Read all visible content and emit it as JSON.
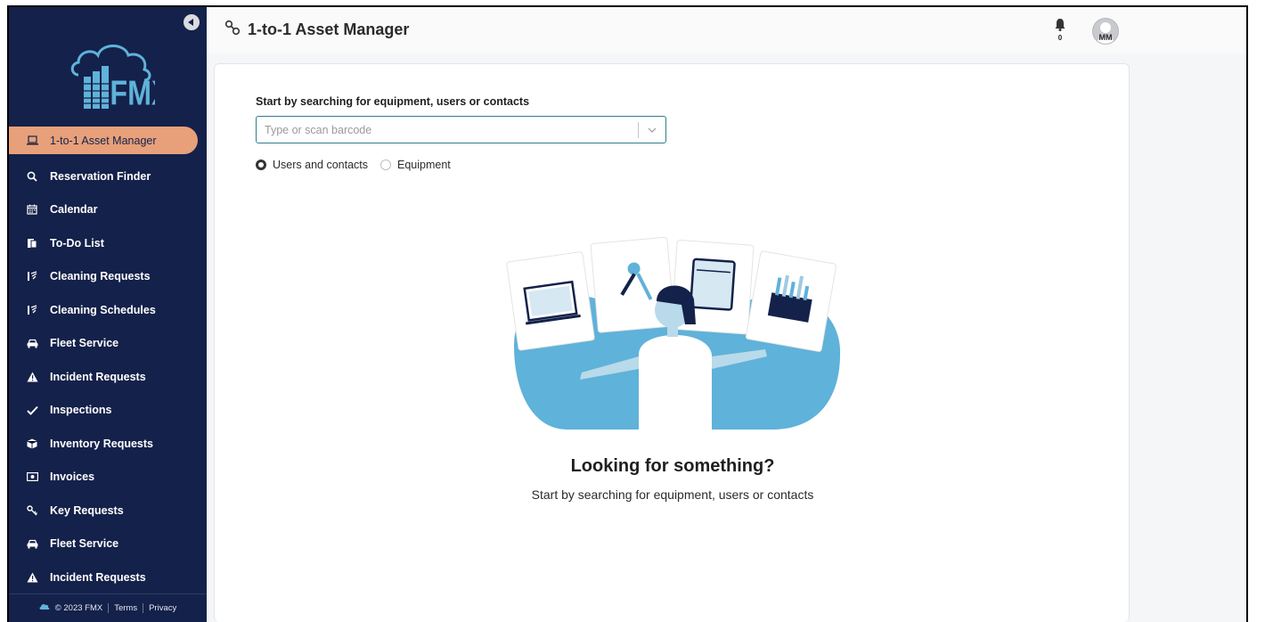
{
  "app": {
    "title": "1-to-1 Asset Manager"
  },
  "sidebar": {
    "logo_text": "FMX",
    "items": [
      {
        "label": "1-to-1 Asset Manager",
        "icon": "laptop-icon",
        "active": true
      },
      {
        "label": "Reservation Finder",
        "icon": "search-icon"
      },
      {
        "label": "Calendar",
        "icon": "calendar-icon"
      },
      {
        "label": "To-Do List",
        "icon": "todo-icon"
      },
      {
        "label": "Cleaning Requests",
        "icon": "broom-icon"
      },
      {
        "label": "Cleaning Schedules",
        "icon": "broom-icon"
      },
      {
        "label": "Fleet Service",
        "icon": "car-icon"
      },
      {
        "label": "Incident Requests",
        "icon": "warning-icon"
      },
      {
        "label": "Inspections",
        "icon": "check-icon"
      },
      {
        "label": "Inventory Requests",
        "icon": "box-icon"
      },
      {
        "label": "Invoices",
        "icon": "money-icon"
      },
      {
        "label": "Key Requests",
        "icon": "key-icon"
      },
      {
        "label": "Fleet Service",
        "icon": "car-icon"
      },
      {
        "label": "Incident Requests",
        "icon": "warning-icon"
      }
    ],
    "footer": {
      "copyright": "© 2023 FMX",
      "terms": "Terms",
      "privacy": "Privacy"
    }
  },
  "header": {
    "notification_count": "0",
    "avatar_initials": "MM"
  },
  "search": {
    "heading": "Start by searching for equipment, users or contacts",
    "placeholder": "Type or scan barcode",
    "options": [
      {
        "label": "Users and contacts",
        "checked": true
      },
      {
        "label": "Equipment",
        "checked": false
      }
    ]
  },
  "empty_state": {
    "title": "Looking for something?",
    "subtitle": "Start by searching for equipment, users or contacts"
  },
  "colors": {
    "sidebar_bg": "#14214a",
    "active_item": "#e8a07a",
    "accent_blue": "#5fb2d9",
    "input_border": "#2e7f8c"
  }
}
